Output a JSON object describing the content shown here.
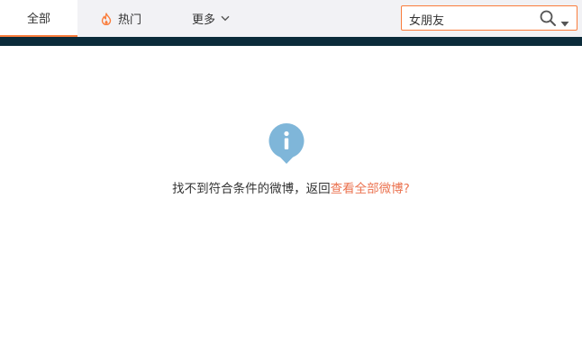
{
  "tabs": {
    "all": "全部",
    "hot": "热门",
    "more": "更多"
  },
  "search": {
    "value": "女朋友"
  },
  "empty_state": {
    "message": "找不到符合条件的微博，返回",
    "link": "查看全部微博?"
  },
  "colors": {
    "accent": "#fa7d3c",
    "link": "#eb7350",
    "info_icon": "#7fb6d9",
    "header_band": "#0b2b3a"
  },
  "icons": {
    "hot": "flame-icon",
    "more": "chevron-down-icon",
    "search": "search-icon",
    "search_menu": "caret-down-icon",
    "empty_state": "info-icon"
  }
}
